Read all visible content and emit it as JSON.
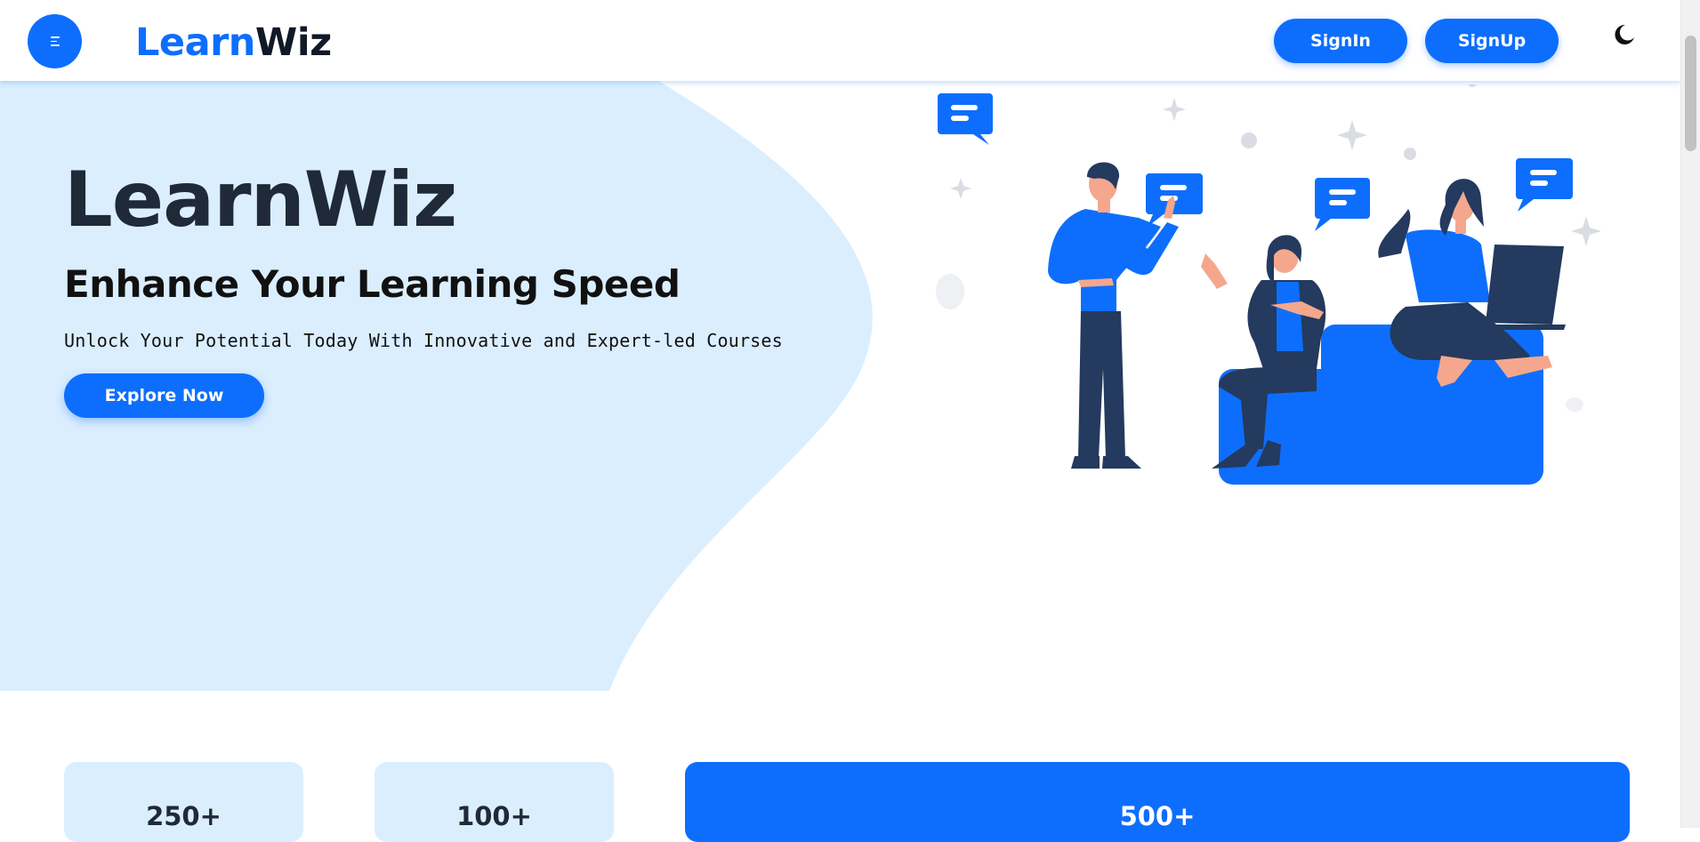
{
  "brand": {
    "part1": "Learn",
    "part2": "Wiz"
  },
  "nav": {
    "signin_label": "SignIn",
    "signup_label": "SignUp"
  },
  "hero": {
    "title": "LearnWiz",
    "subtitle": "Enhance Your Learning Speed",
    "tagline": "Unlock Your Potential Today With Innovative and Expert-led Courses",
    "cta_label": "Explore Now"
  },
  "stats": [
    {
      "value": "250+"
    },
    {
      "value": "100+"
    },
    {
      "value": "500+"
    }
  ],
  "icons": {
    "menu": "menu-icon",
    "theme": "moon-icon",
    "illustration": "people-discussion-illustration"
  },
  "colors": {
    "primary": "#0d6efd",
    "hero_bg": "#dbeefe",
    "dark_navy": "#1f3a5f",
    "text_dark": "#1f2937"
  }
}
